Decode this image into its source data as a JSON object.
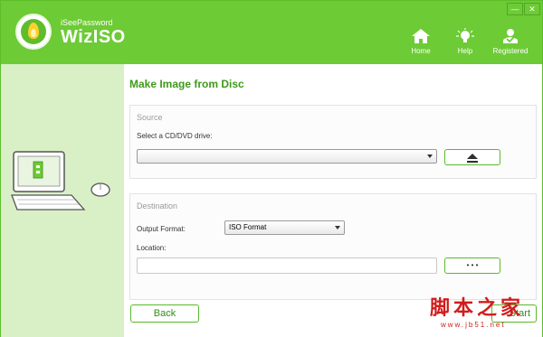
{
  "header": {
    "brand_small": "iSeePassword",
    "brand_name": "WizISO",
    "window_controls": {
      "minimize": "—",
      "close": "✕"
    },
    "nav": [
      {
        "label": "Home",
        "icon": "home-icon"
      },
      {
        "label": "Help",
        "icon": "lightbulb-icon"
      },
      {
        "label": "Registered",
        "icon": "registered-user-icon"
      }
    ]
  },
  "main": {
    "title": "Make Image from Disc",
    "source": {
      "group_title": "Source",
      "drive_label": "Select a CD/DVD drive:",
      "drive_value": "",
      "eject_icon": "eject-icon"
    },
    "destination": {
      "group_title": "Destination",
      "format_label": "Output Format:",
      "format_value": "ISO Format",
      "location_label": "Location:",
      "location_value": "",
      "browse_label": "• • •"
    },
    "back_label": "Back",
    "start_label": "Start"
  },
  "watermark": {
    "chinese": "脚本之家",
    "url": "www.jb51.net"
  },
  "colors": {
    "header_green": "#6dcb36",
    "panel_green": "#d9f0c7",
    "title_green": "#3e9a1a",
    "watermark_red": "#d11c1c"
  }
}
